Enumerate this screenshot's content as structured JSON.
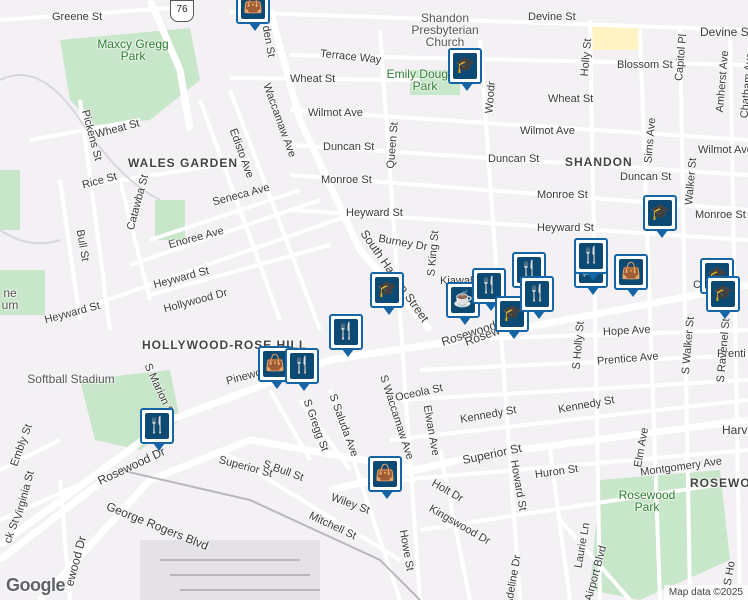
{
  "attribution": {
    "logo": "Google",
    "map_data": "Map data ©2025"
  },
  "route_shield": "76",
  "districts": [
    "WALES GARDEN",
    "SHANDON",
    "HOLLYWOOD-ROSE HILL",
    "ROSEWO"
  ],
  "parks": [
    "Maxcy Gregg Park",
    "Emily Douglas Park",
    "Rosewood Park"
  ],
  "poi": [
    "Shandon Presbyterian Church",
    "Softball Stadium",
    "ne um"
  ],
  "streets": [
    "Greene St",
    "Devine St",
    "Devine St",
    "Terrace Way",
    "Blossom St",
    "Wheat St",
    "Wheat St",
    "Wheat St",
    "Wilmot Ave",
    "Wilmot Ave",
    "Wilmot Ave",
    "Duncan St",
    "Duncan St",
    "Duncan St",
    "Monroe St",
    "Monroe St",
    "Monroe St",
    "Heyward St",
    "Heyward St",
    "Heyward St",
    "Heyward St",
    "Burney Dr",
    "Kiawah",
    "Hope Ave",
    "Prentice Ave",
    "Prenti",
    "Oceola St",
    "Kennedy St",
    "Kennedy St",
    "Superior St",
    "Superior St",
    "Huron St",
    "Montgomery Ave",
    "Holt Dr",
    "Kingswood Dr",
    "Wiley St",
    "Mitchell St",
    "George Rogers Blvd",
    "Rosewood Dr",
    "Rosewood Dr",
    "Rosew",
    "Seneca Ave",
    "Enoree Ave",
    "Hollywood Dr",
    "Pinewo",
    "Catawba St",
    "Rice St",
    "Pickens St",
    "Bull St",
    "Waccamaw Ave",
    "Edisto Ave",
    "South Harden Street",
    "den St",
    "Queen St",
    "S King St",
    "Woodr",
    "Holly St",
    "Capitol Pl",
    "Amherst Ave",
    "Chatham Ave",
    "Sims Ave",
    "S Walker St",
    "Walker St",
    "S Ravenel St",
    "S Holly St",
    "Elm Ave",
    "Laurie Ln",
    "Airport Blvd",
    "Howard St",
    "Elwan Ave",
    "S Waccamaw Ave",
    "S Saluda Ave",
    "S Gregg St",
    "S Bull St",
    "S Marion St",
    "Howe St",
    "Adeline Dr",
    "Virginia St",
    "Embly St",
    "ck St",
    "ewood Dr",
    "Harv",
    "C",
    "S Ho"
  ],
  "markers": [
    {
      "icon": "shopping-bag-icon",
      "glyph": "👜"
    },
    {
      "icon": "school-icon",
      "glyph": "🎓"
    },
    {
      "icon": "school-icon",
      "glyph": "🎓"
    },
    {
      "icon": "school-icon",
      "glyph": "🎓"
    },
    {
      "icon": "restaurant-icon",
      "glyph": "🍴"
    },
    {
      "icon": "shopping-bag-icon",
      "glyph": "👜"
    },
    {
      "icon": "restaurant-icon",
      "glyph": "🍴"
    },
    {
      "icon": "restaurant-icon",
      "glyph": "🍴"
    },
    {
      "icon": "shopping-bag-icon",
      "glyph": "👜"
    },
    {
      "icon": "coffee-icon",
      "glyph": "☕"
    },
    {
      "icon": "restaurant-icon",
      "glyph": "🍴"
    },
    {
      "icon": "school-icon",
      "glyph": "🎓"
    },
    {
      "icon": "restaurant-icon",
      "glyph": "🍴"
    },
    {
      "icon": "restaurant-icon",
      "glyph": "🍴"
    },
    {
      "icon": "shopping-cart-icon",
      "glyph": "🛒"
    },
    {
      "icon": "shopping-bag-icon",
      "glyph": "👜"
    },
    {
      "icon": "school-icon",
      "glyph": "🎓"
    },
    {
      "icon": "school-icon",
      "glyph": "🎓"
    },
    {
      "icon": "restaurant-icon",
      "glyph": "🍴"
    }
  ]
}
